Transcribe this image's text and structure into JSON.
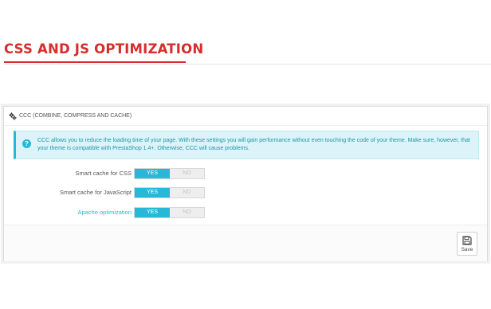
{
  "page": {
    "heading": "CSS AND JS OPTIMIZATION",
    "accent_color": "#d62d2d"
  },
  "panel": {
    "title": "CCC (COMBINE, COMPRESS AND CACHE)",
    "title_icon": "cogs-icon",
    "alert": {
      "icon": "info-icon",
      "text": "CCC allows you to reduce the loading time of your page. With these settings you will gain performance without even touching the code of your theme. Make sure, however, that your theme is compatible with PrestaShop 1.4+. Otherwise, CCC will cause problems."
    },
    "settings": [
      {
        "label": "Smart cache for CSS",
        "yes": "YES",
        "no": "NO",
        "value": "YES"
      },
      {
        "label": "Smart cache for JavaScript",
        "yes": "YES",
        "no": "NO",
        "value": "YES"
      },
      {
        "label": "Apache optimization",
        "yes": "YES",
        "no": "NO",
        "value": "YES"
      }
    ],
    "save_label": "Save",
    "save_icon": "floppy-disk-icon",
    "toggle_color": "#25b9d7"
  }
}
